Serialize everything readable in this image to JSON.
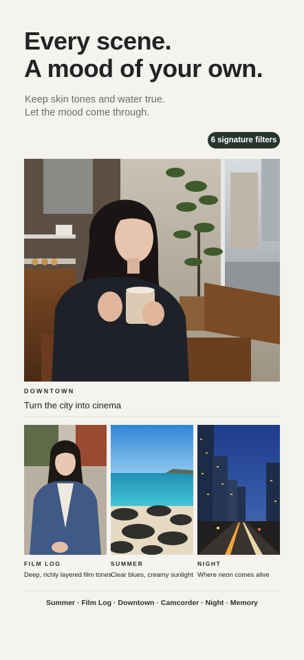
{
  "headline": {
    "line1": "Every scene.",
    "line2": "A mood of your own."
  },
  "subtitle": {
    "line1": "Keep skin tones and water true.",
    "line2": "Let the mood come through."
  },
  "badge": {
    "label": "6 signature filters"
  },
  "hero": {
    "category": "DOWNTOWN",
    "caption": "Turn the city into cinema"
  },
  "cards": [
    {
      "category": "FILM LOG",
      "caption": "Deep, richly layered film tones"
    },
    {
      "category": "SUMMER",
      "caption": "Clear blues, creamy sunlight"
    },
    {
      "category": "NIGHT",
      "caption": "Where neon comes alive"
    }
  ],
  "filters_line": "Summer · Film Log · Downtown · Camcorder · Night · Memory",
  "colors": {
    "background": "#f4f3ef",
    "badge_bg": "#27352e",
    "badge_text": "#ffffff",
    "heading": "#232323",
    "muted": "#6c6c6c"
  }
}
